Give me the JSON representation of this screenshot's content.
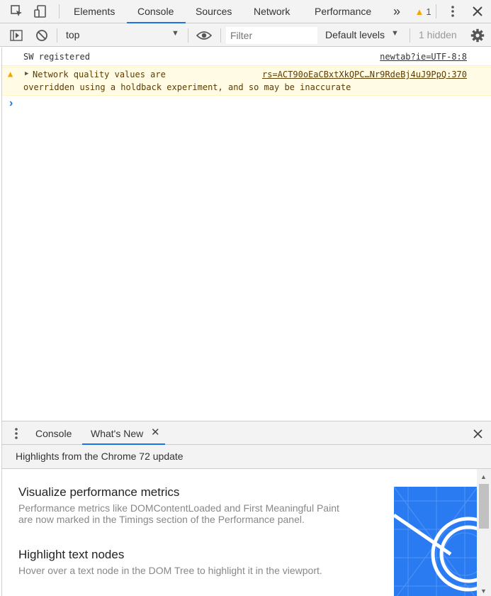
{
  "toolbar": {
    "tabs": [
      {
        "label": "Elements"
      },
      {
        "label": "Console",
        "active": true
      },
      {
        "label": "Sources"
      },
      {
        "label": "Network"
      },
      {
        "label": "Performance"
      }
    ],
    "more_tabs_icon": "double-chevron-right-icon",
    "warning_count": "1",
    "accent_color": "#1a73e8",
    "warning_color": "#f2a600"
  },
  "console_toolbar": {
    "context": "top",
    "filter_placeholder": "Filter",
    "levels_label": "Default levels",
    "hidden_label": "1 hidden"
  },
  "messages": [
    {
      "type": "log",
      "text": "SW registered",
      "source": "newtab?ie=UTF-8:8"
    },
    {
      "type": "warning",
      "line1": "Network quality values are",
      "line2": "overridden using a holdback experiment, and so may be inaccurate",
      "source": "rs=ACT90oEaCBxtXkQPC…Nr9RdeBj4uJ9PpQ:370"
    }
  ],
  "drawer": {
    "tabs": [
      {
        "label": "Console"
      },
      {
        "label": "What's New",
        "active": true
      }
    ],
    "subtitle": "Highlights from the Chrome 72 update",
    "features": [
      {
        "title": "Visualize performance metrics",
        "desc": "Performance metrics like DOMContentLoaded and First Meaningful Paint are now marked in the Timings section of the Performance panel."
      },
      {
        "title": "Highlight text nodes",
        "desc": "Hover over a text node in the DOM Tree to highlight it in the viewport."
      }
    ],
    "image_color": "#2a7bf2"
  }
}
